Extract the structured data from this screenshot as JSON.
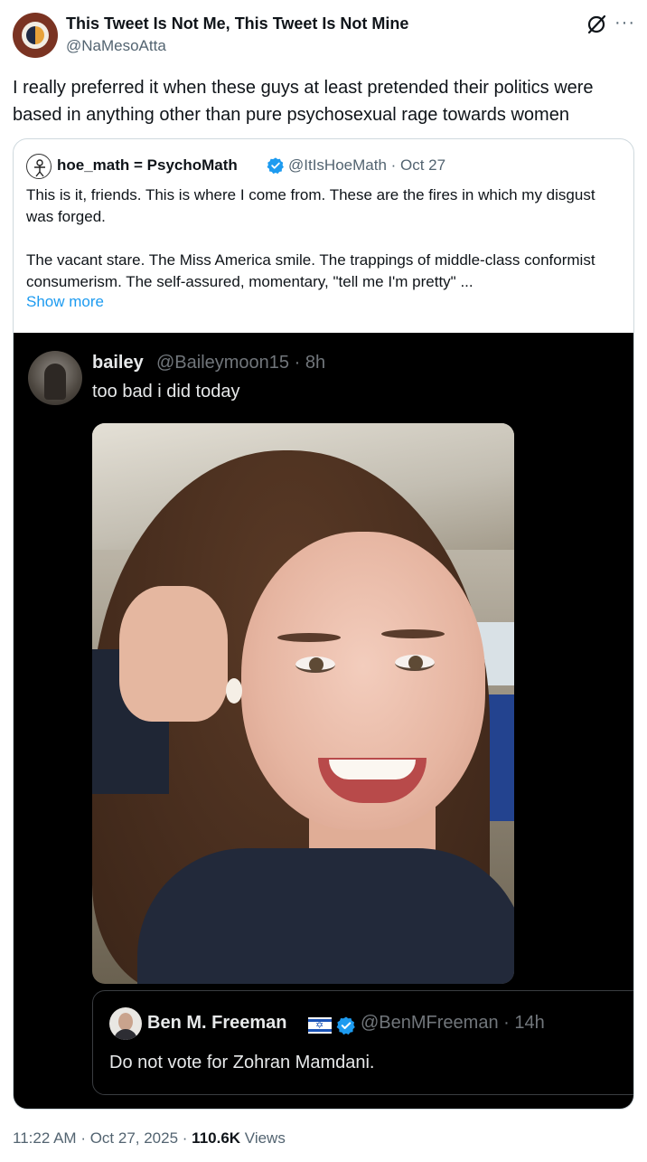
{
  "tweet": {
    "author_name": "This Tweet Is Not Me, This Tweet Is Not Mine",
    "author_handle": "@NaMesoAtta",
    "text": "I really preferred it when these guys at least pretended their politics were based in anything other than pure psychosexual rage towards women",
    "time": "11:22 AM",
    "date": "Oct 27, 2025",
    "views_count": "110.6K",
    "views_label": "Views",
    "icons": {
      "grok": "grok-icon",
      "more": "more-icon"
    }
  },
  "quote": {
    "name": "hoe_math = PsychoMath",
    "handle_date": "@ItIsHoeMath · Oct 27",
    "paragraph1": "This is it, friends. This is where I come from. These are the fires in which my disgust was forged.",
    "paragraph2": "The vacant stare. The Miss America smile. The trappings of middle-class conformist consumerism. The self-assured, momentary, \"tell me I'm pretty\" ...",
    "show_more": "Show more",
    "verified_color": "#1d9bf0",
    "screenshot": {
      "reply_name": "bailey",
      "reply_handle_time": "@Baileymoon15 · 8h",
      "reply_text": "too bad i did today",
      "nested": {
        "name": "Ben M. Freeman",
        "handle_time": "@BenMFreeman · 14h",
        "text": "Do not vote for Zohran Mamdani."
      }
    }
  },
  "colors": {
    "text_primary": "#0f1419",
    "text_secondary": "#536471",
    "link": "#1d9bf0",
    "dark_bg": "#000000"
  }
}
